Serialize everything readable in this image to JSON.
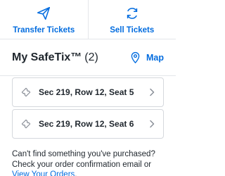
{
  "actions": {
    "transfer_label": "Transfer Tickets",
    "sell_label": "Sell Tickets",
    "transfer_icon": "paper-plane-icon",
    "sell_icon": "refresh-arrows-icon"
  },
  "header": {
    "title": "My SafeTix™",
    "count": "(2)",
    "map_label": "Map",
    "map_icon": "map-pin-icon"
  },
  "tickets": [
    {
      "label": "Sec 219, Row 12, Seat 5",
      "icon": "ticket-icon"
    },
    {
      "label": "Sec 219, Row 12, Seat 6",
      "icon": "ticket-icon"
    }
  ],
  "help": {
    "text": "Can't find something you've purchased? Check your order confirmation email or ",
    "link_label": "View Your Orders",
    "suffix": "."
  },
  "colors": {
    "accent": "#026cdf",
    "text": "#1f262d",
    "border": "#d5d8dd",
    "icon_gray": "#8a8f98"
  }
}
